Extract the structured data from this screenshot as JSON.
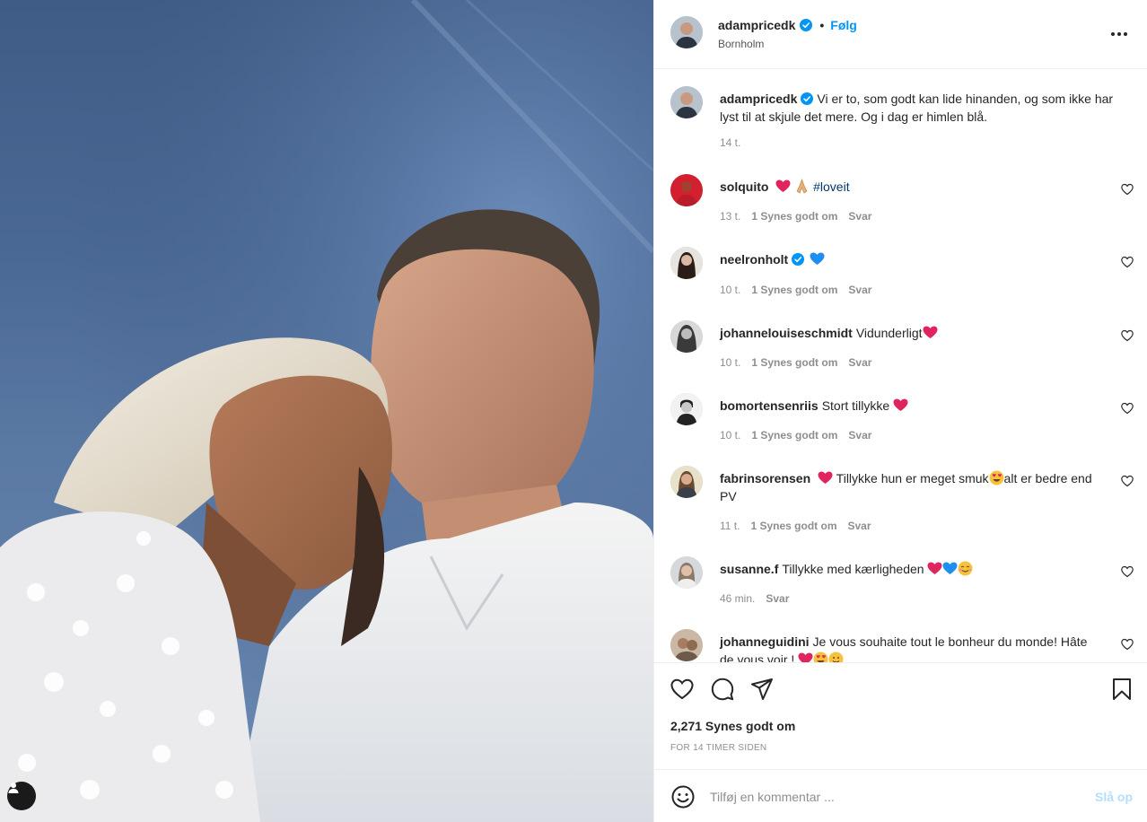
{
  "photo": {
    "alt": "Selfie of a couple against a blue sky",
    "user_tag_icon": "user-icon"
  },
  "header": {
    "username": "adampricedk",
    "verified_icon": "verified-badge-icon",
    "separator": "•",
    "follow_label": "Følg",
    "location": "Bornholm",
    "more_icon": "more-options-icon"
  },
  "caption": {
    "username": "adampricedk",
    "text": "Vi er to, som godt kan lide hinanden, og som ikke har lyst til at skjule det mere. Og i dag er himlen blå.",
    "time": "14 t."
  },
  "comments": [
    {
      "username": "solquito",
      "text_after_emoji": "",
      "hashtag": "#loveit",
      "time": "13 t.",
      "likes": "1 Synes godt om",
      "reply": "Svar"
    },
    {
      "username": "neelronholt",
      "time": "10 t.",
      "likes": "1 Synes godt om",
      "reply": "Svar"
    },
    {
      "username": "johannelouiseschmidt",
      "text": "Vidunderligt",
      "time": "10 t.",
      "likes": "1 Synes godt om",
      "reply": "Svar"
    },
    {
      "username": "bomortensenriis",
      "text": "Stort tillykke",
      "time": "10 t.",
      "likes": "1 Synes godt om",
      "reply": "Svar"
    },
    {
      "username": "fabrinsorensen",
      "text_a": "Tillykke hun er meget smuk",
      "text_b": "alt er bedre end PV",
      "time": "11 t.",
      "likes": "1 Synes godt om",
      "reply": "Svar"
    },
    {
      "username": "susanne.f",
      "text": "Tillykke med kærligheden",
      "time": "46 min.",
      "reply": "Svar"
    },
    {
      "username": "johanneguidini",
      "text": "Je vous souhaite tout le bonheur du monde! Hâte de vous voir !"
    }
  ],
  "actions": {
    "like_icon": "heart-icon",
    "comment_icon": "comment-icon",
    "share_icon": "share-icon",
    "save_icon": "bookmark-icon",
    "likes_count": "2,271 Synes godt om",
    "posted_ago": "FOR 14 TIMER SIDEN"
  },
  "add_comment": {
    "emoji_icon": "emoji-icon",
    "placeholder": "Tilføj en kommentar ...",
    "post_label": "Slå op"
  },
  "colors": {
    "accent": "#0095f6",
    "hashtag": "#00376b",
    "muted": "#8e8e8e",
    "heart_red": "#e0245e",
    "heart_blue": "#1d8ff0"
  }
}
